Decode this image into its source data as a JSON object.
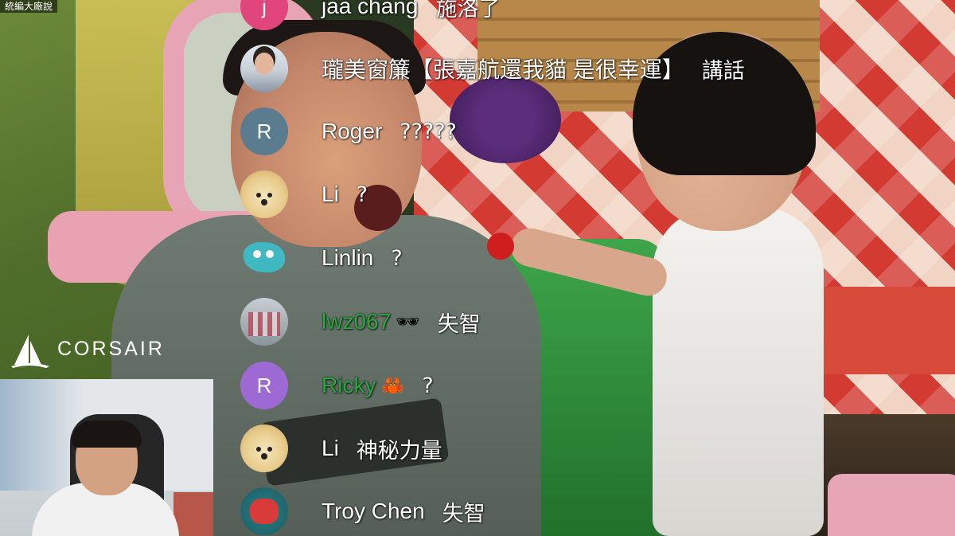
{
  "watermark": "統編大廠說",
  "sponsor": {
    "name": "CORSAIR"
  },
  "colors": {
    "member_name": "#2ba640",
    "normal_name": "#ffffff",
    "avatar_pink": "#e0457b",
    "avatar_slate": "#5a7c8e",
    "avatar_purple": "#9c6ad2"
  },
  "chat": {
    "messages": [
      {
        "avatar": {
          "type": "letter",
          "letter": "j",
          "color": "#e0457b"
        },
        "author": "jaa chang",
        "member": false,
        "badge": "",
        "text": "施洛了"
      },
      {
        "avatar": {
          "type": "photo",
          "icon": "user-photo-avatar"
        },
        "author": "瓏美窗簾【張嘉航還我貓 是很幸運】",
        "member": false,
        "badge": "",
        "text": "講話"
      },
      {
        "avatar": {
          "type": "letter",
          "letter": "R",
          "color": "#5a7c8e"
        },
        "author": "Roger",
        "member": false,
        "badge": "",
        "text": "?????"
      },
      {
        "avatar": {
          "type": "doge",
          "icon": "doge-avatar"
        },
        "author": "Li",
        "member": false,
        "badge": "",
        "text": "?"
      },
      {
        "avatar": {
          "type": "cartoon",
          "icon": "teal-cartoon-avatar"
        },
        "author": "Linlin",
        "member": false,
        "badge": "",
        "text": "?"
      },
      {
        "avatar": {
          "type": "photo",
          "icon": "street-photo-avatar"
        },
        "author": "lwz067",
        "member": true,
        "badge": "🕶",
        "text": "失智"
      },
      {
        "avatar": {
          "type": "letter",
          "letter": "R",
          "color": "#9c6ad2"
        },
        "author": "Ricky",
        "member": true,
        "badge": "🦀",
        "text": "?"
      },
      {
        "avatar": {
          "type": "doge",
          "icon": "doge-avatar"
        },
        "author": "Li",
        "member": false,
        "badge": "",
        "text": "神秘力量"
      },
      {
        "avatar": {
          "type": "cartoon",
          "icon": "boxing-glove-avatar"
        },
        "author": "Troy Chen",
        "member": false,
        "badge": "",
        "text": "失智"
      }
    ]
  }
}
